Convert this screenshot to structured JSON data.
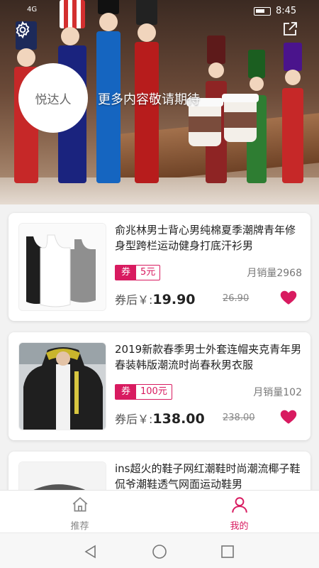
{
  "status_bar": {
    "time": "8:45",
    "signal": "4G"
  },
  "header": {
    "settings_icon": "gear-icon",
    "share_icon": "share-icon",
    "avatar_text": "悦达人",
    "caption": "更多内容敬请期待"
  },
  "products": [
    {
      "title": "俞兆林男士背心男纯棉夏季潮牌青年修身型跨栏运动健身打底汗衫男",
      "coupon_tag": "券",
      "coupon_value": "5元",
      "monthly_sales": "月销量2968",
      "price_prefix": "券后￥:",
      "price": "19.90",
      "original_price": "26.90"
    },
    {
      "title": "2019新款春季男士外套连帽夹克青年男春装韩版潮流时尚春秋男衣服",
      "coupon_tag": "券",
      "coupon_value": "100元",
      "monthly_sales": "月销量102",
      "price_prefix": "券后￥:",
      "price": "138.00",
      "original_price": "238.00"
    },
    {
      "title": "ins超火的鞋子网红潮鞋时尚潮流椰子鞋侃爷潮鞋透气网面运动鞋男"
    }
  ],
  "tabbar": {
    "tabs": [
      {
        "label": "推荐",
        "icon": "home-icon",
        "active": false
      },
      {
        "label": "我的",
        "icon": "person-icon",
        "active": true
      }
    ]
  },
  "colors": {
    "accent": "#d81b60",
    "inactive": "#888888"
  }
}
